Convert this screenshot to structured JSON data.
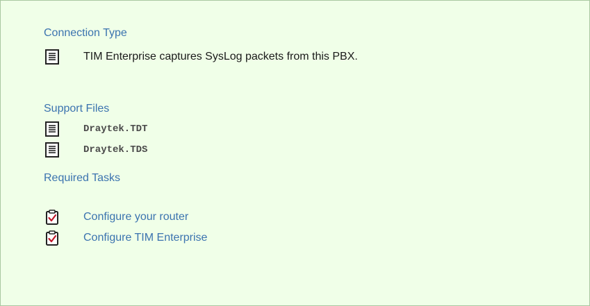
{
  "connection": {
    "title": "Connection Type",
    "icon": "document-icon",
    "text": "TIM Enterprise captures SysLog packets from this PBX."
  },
  "support": {
    "title": "Support Files",
    "files": [
      {
        "icon": "document-icon",
        "name": "Draytek.TDT"
      },
      {
        "icon": "document-icon",
        "name": "Draytek.TDS"
      }
    ]
  },
  "tasks": {
    "title": "Required Tasks",
    "items": [
      {
        "icon": "checklist-icon",
        "label": "Configure your router"
      },
      {
        "icon": "checklist-icon",
        "label": "Configure TIM Enterprise"
      }
    ]
  },
  "colors": {
    "panel_bg": "#f0ffe8",
    "panel_border": "#a8c8a0",
    "heading": "#3b73af",
    "link": "#3b73af",
    "check": "#c0182a"
  }
}
